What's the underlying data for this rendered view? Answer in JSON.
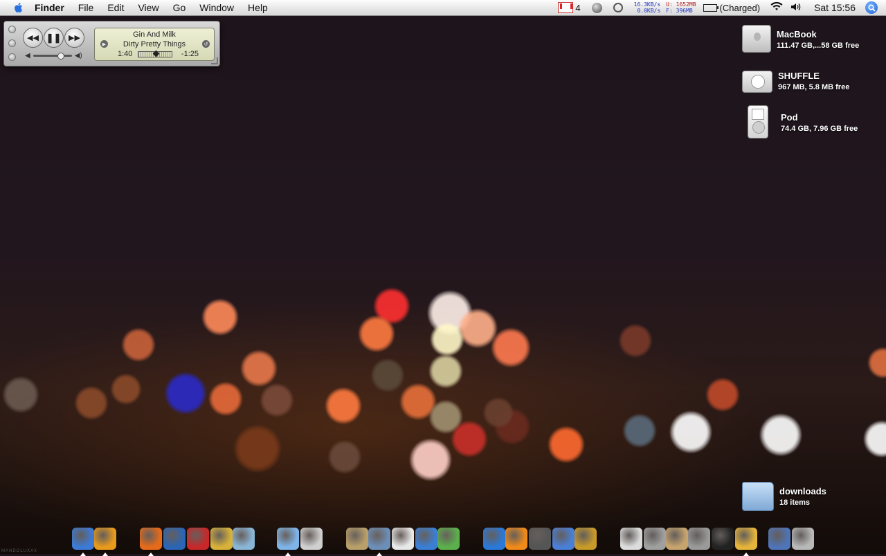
{
  "menubar": {
    "app_name": "Finder",
    "menus": [
      "File",
      "Edit",
      "View",
      "Go",
      "Window",
      "Help"
    ],
    "gmail_count": "4",
    "net_up": "16.3KB/s",
    "net_down": "0.0KB/s",
    "mem_used": "U: 1652MB",
    "mem_free": "F:  396MB",
    "battery": "(Charged)",
    "clock": "Sat 15:56"
  },
  "mini_player": {
    "track": "Gin And Milk",
    "artist": "Dirty Pretty Things",
    "elapsed": "1:40",
    "remaining": "-1:25",
    "progress": 0.54,
    "volume": 0.7
  },
  "desktop": {
    "items": [
      {
        "name": "MacBook",
        "info": "111.47 GB,...58 GB free",
        "icon": "hard-drive-icon"
      },
      {
        "name": "SHUFFLE",
        "info": "967 MB, 5.8 MB free",
        "icon": "ipod-shuffle-icon"
      },
      {
        "name": "Pod",
        "info": "74.4 GB, 7.96 GB free",
        "icon": "ipod-icon"
      },
      {
        "name": "downloads",
        "info": "18 items",
        "icon": "folder-icon"
      }
    ]
  },
  "dock": {
    "items": [
      {
        "name": "finder",
        "color": "#3c7ad6",
        "running": true
      },
      {
        "name": "bittorrent",
        "color": "#e89a1c",
        "running": true
      },
      {
        "name": "firefox",
        "color": "#e56a1a",
        "running": true
      },
      {
        "name": "thunderbird",
        "color": "#2b65b5",
        "running": false
      },
      {
        "name": "magnet-app",
        "color": "#c8282a",
        "running": false
      },
      {
        "name": "transmit",
        "color": "#d7b13a",
        "running": false
      },
      {
        "name": "printer-app",
        "color": "#8ab6d6",
        "running": false
      },
      {
        "name": "itunes",
        "color": "#7fb4e8",
        "running": true
      },
      {
        "name": "dvd-player",
        "color": "#cfcfcf",
        "running": false
      },
      {
        "name": "pen-app",
        "color": "#b9a06a",
        "running": false
      },
      {
        "name": "iphoto",
        "color": "#6c8fb8",
        "running": true
      },
      {
        "name": "textedit",
        "color": "#e8e8e8",
        "running": false
      },
      {
        "name": "word-app",
        "color": "#3a7fd4",
        "running": false
      },
      {
        "name": "plant-app",
        "color": "#5bb04c",
        "running": false
      },
      {
        "name": "quicktime",
        "color": "#2a78d8",
        "running": false
      },
      {
        "name": "vlc",
        "color": "#f08a18",
        "running": false
      },
      {
        "name": "film-app",
        "color": "#555555",
        "running": false
      },
      {
        "name": "ff-app",
        "color": "#4a7fd8",
        "running": false
      },
      {
        "name": "cocktail-app",
        "color": "#c89a2a",
        "running": false
      },
      {
        "name": "system-app",
        "color": "#dcdcdc",
        "running": false
      },
      {
        "name": "disk-utility",
        "color": "#a0a0a0",
        "running": false
      },
      {
        "name": "installer",
        "color": "#c7a46e",
        "running": false
      },
      {
        "name": "calculator",
        "color": "#9a9a9a",
        "running": false
      },
      {
        "name": "terminal",
        "color": "#222222",
        "running": false
      },
      {
        "name": "pretzel-app",
        "color": "#e6b43a",
        "running": true
      },
      {
        "name": "id-card-app",
        "color": "#4f74b8",
        "running": false
      },
      {
        "name": "trash",
        "color": "#b8b8b8",
        "running": false
      }
    ]
  },
  "watermark": "MANDOLUXXX"
}
